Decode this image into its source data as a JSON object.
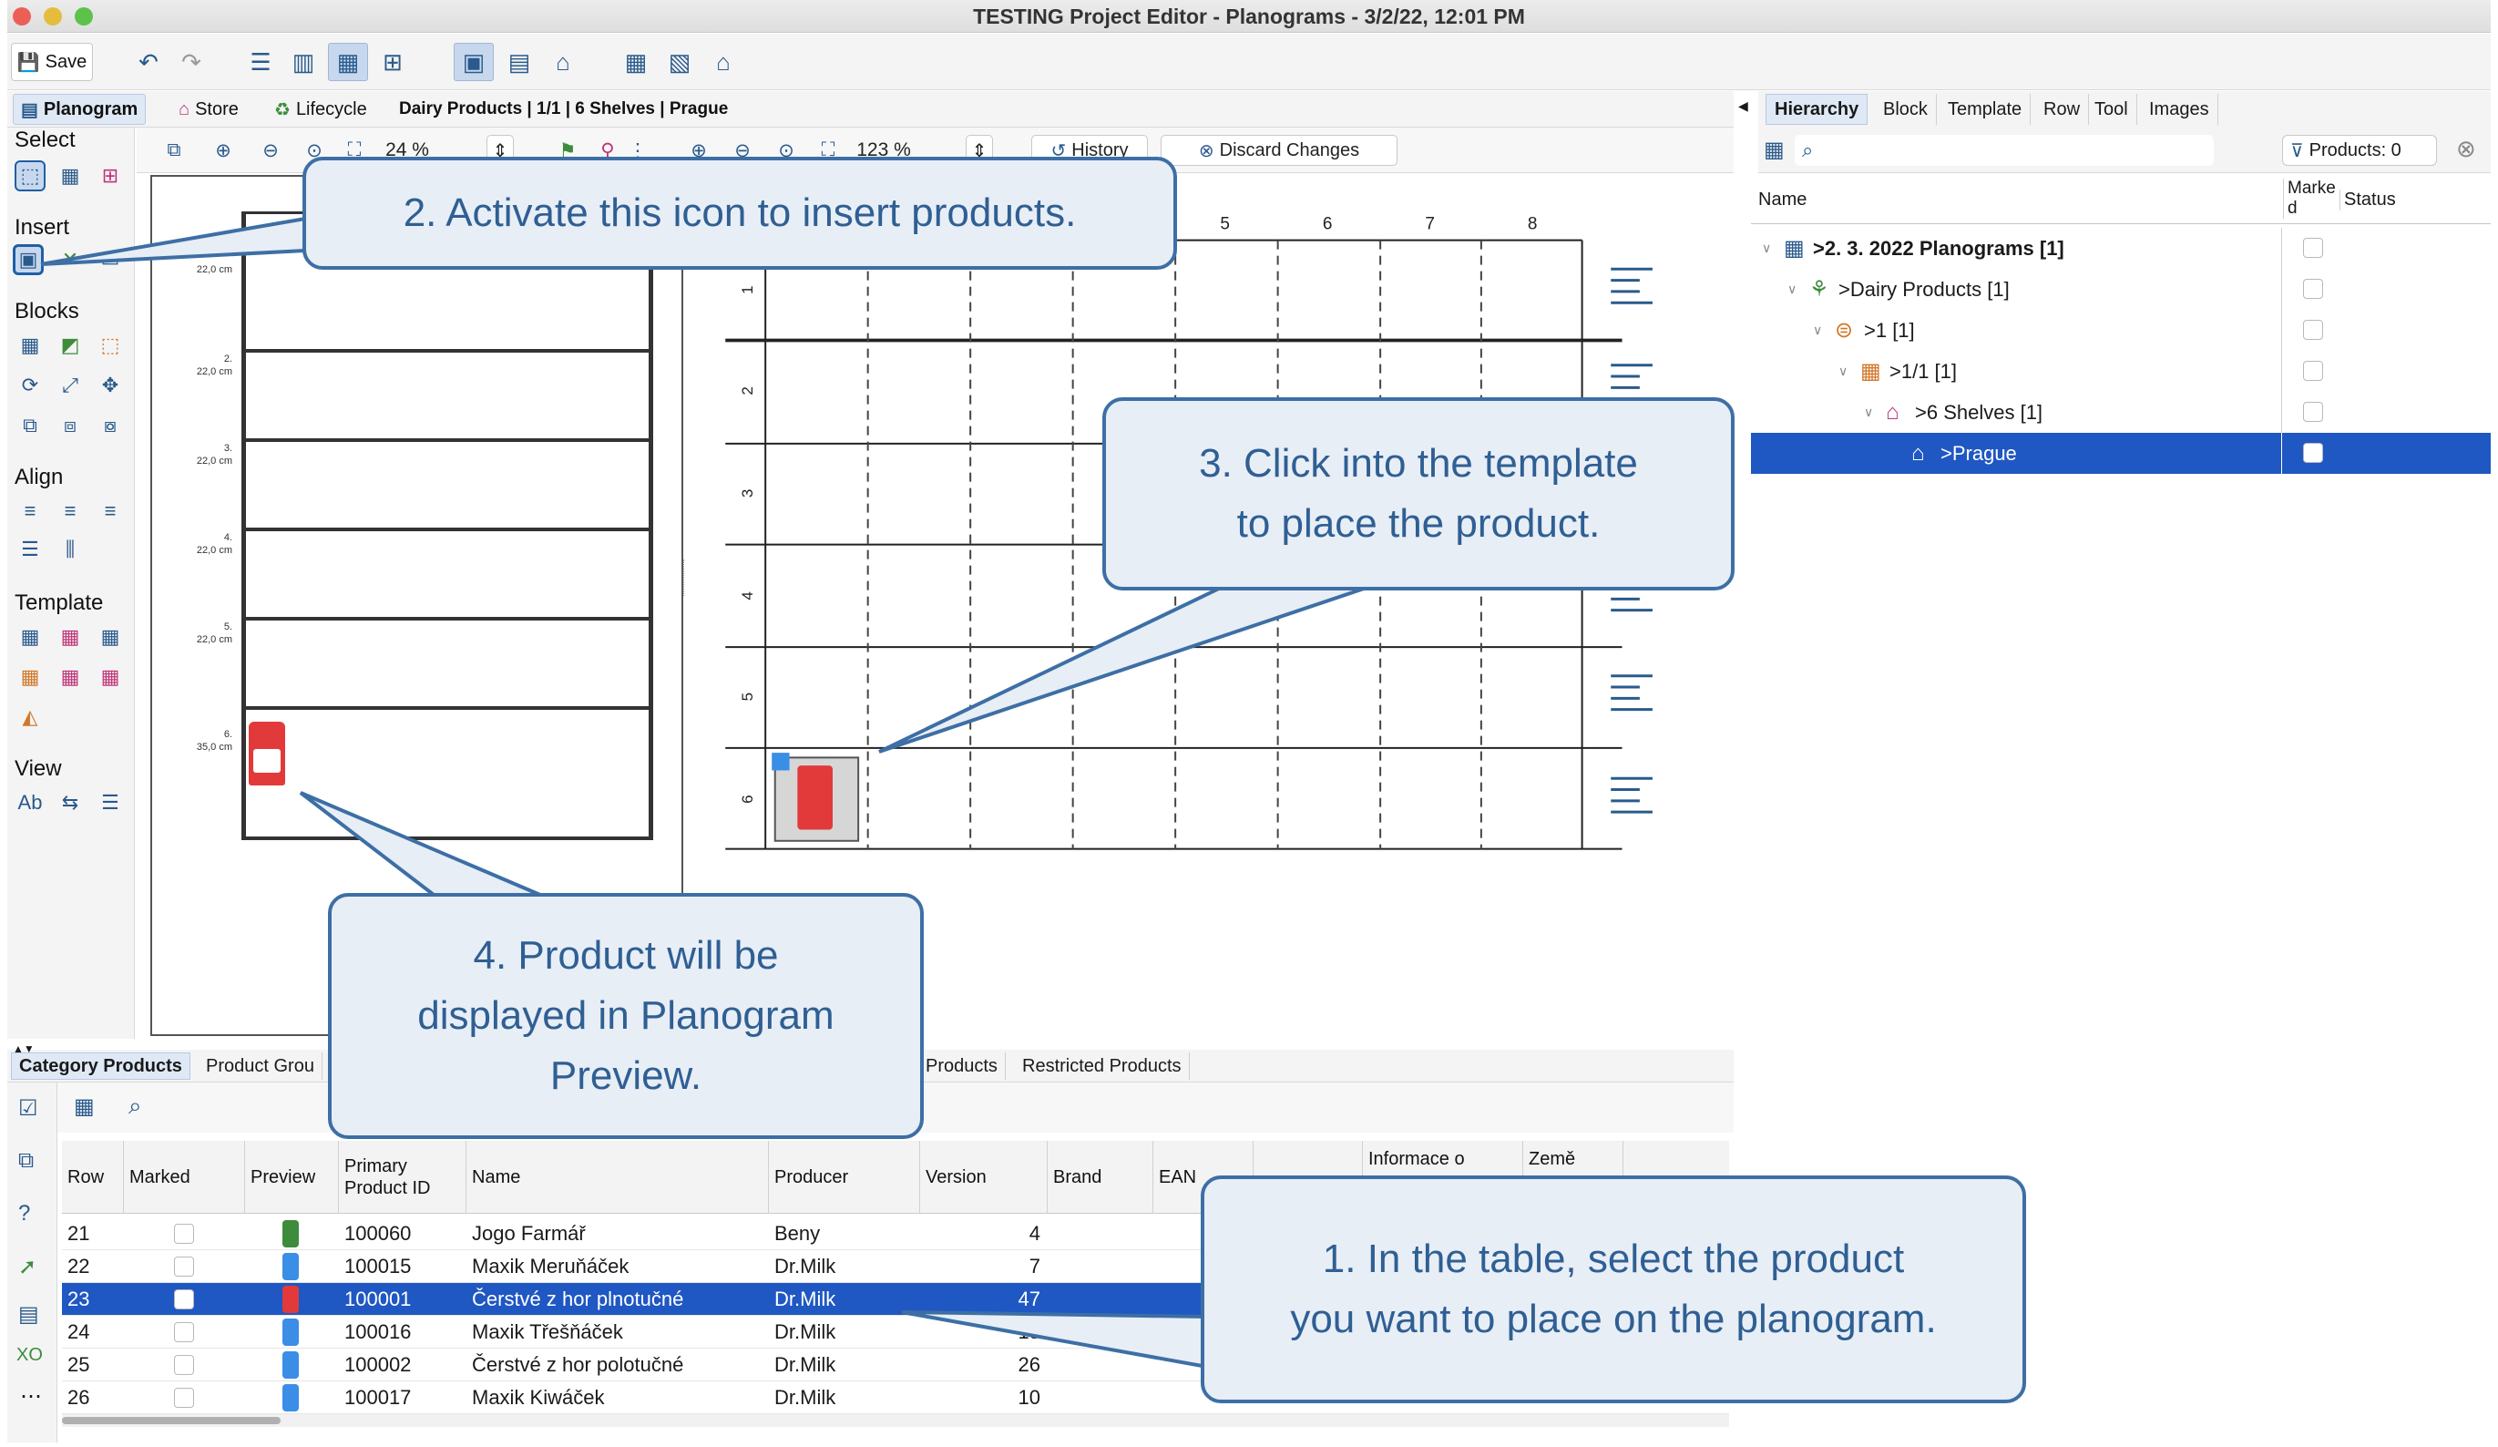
{
  "window": {
    "title": "TESTING Project Editor - Planograms - 3/2/22, 12:01 PM"
  },
  "toolbar": {
    "save_label": "Save"
  },
  "tabs": {
    "planogram": "Planogram",
    "store": "Store",
    "lifecycle": "Lifecycle",
    "info": "Dairy Products | 1/1 | 6 Shelves | Prague"
  },
  "right_tabs": [
    "Hierarchy",
    "Block",
    "Template",
    "Row",
    "Tool",
    "Images"
  ],
  "palette": {
    "select": "Select",
    "insert": "Insert",
    "blocks": "Blocks",
    "align": "Align",
    "template": "Template",
    "view": "View"
  },
  "zoombar": {
    "zoom_left": "24 %",
    "zoom_right": "123 %",
    "history": "History",
    "discard": "Discard Changes"
  },
  "preview": {
    "shelves": [
      {
        "num": "",
        "height": "22,0 cm"
      },
      {
        "num": "2.",
        "height": "22,0 cm"
      },
      {
        "num": "3.",
        "height": "22,0 cm"
      },
      {
        "num": "4.",
        "height": "22,0 cm"
      },
      {
        "num": "5.",
        "height": "22,0 cm"
      },
      {
        "num": "6.",
        "height": "35,0 cm"
      }
    ]
  },
  "template": {
    "columns": [
      "5",
      "6",
      "7",
      "8"
    ],
    "rows": [
      "1",
      "2",
      "3",
      "4",
      "5",
      "6"
    ]
  },
  "hierarchy": {
    "search_placeholder": "",
    "products_count": "Products: 0",
    "col_name": "Name",
    "col_marked": "Marke d",
    "col_status": "Status",
    "rows": [
      {
        "label": ">2. 3. 2022 Planograms [1]"
      },
      {
        "label": ">Dairy Products [1]"
      },
      {
        "label": ">1 [1]"
      },
      {
        "label": ">1/1 [1]"
      },
      {
        "label": ">6 Shelves [1]"
      },
      {
        "label": ">Prague"
      }
    ]
  },
  "bottom_tabs": {
    "category_products": "Category Products",
    "product_groups": "Product Grou",
    "products": "Products",
    "restricted_products": "Restricted Products"
  },
  "table": {
    "headers": {
      "row": "Row",
      "marked": "Marked",
      "preview": "Preview",
      "primary_id": "Primary Product ID",
      "name": "Name",
      "producer": "Producer",
      "version": "Version",
      "brand": "Brand",
      "ean": "EAN",
      "info": "Informace o",
      "country": "Země"
    },
    "rows": [
      {
        "row": "21",
        "id": "100060",
        "name": "Jogo Farmář",
        "producer": "Beny",
        "version": "4"
      },
      {
        "row": "22",
        "id": "100015",
        "name": "Maxik Meruňáček",
        "producer": "Dr.Milk",
        "version": "7"
      },
      {
        "row": "23",
        "id": "100001",
        "name": "Čerstvé z hor plnotučné",
        "producer": "Dr.Milk",
        "version": "47"
      },
      {
        "row": "24",
        "id": "100016",
        "name": "Maxik Třešňáček",
        "producer": "Dr.Milk",
        "version": "15"
      },
      {
        "row": "25",
        "id": "100002",
        "name": "Čerstvé z hor polotučné",
        "producer": "Dr.Milk",
        "version": "26"
      },
      {
        "row": "26",
        "id": "100017",
        "name": "Maxik Kiwáček",
        "producer": "Dr.Milk",
        "version": "10"
      }
    ]
  },
  "callouts": {
    "c1_line1": "1. In the table, select the product",
    "c1_line2": "you want to place on the planogram.",
    "c2": "2. Activate this icon to insert products.",
    "c3_line1": "3. Click into the template",
    "c3_line2": "to place the product.",
    "c4_line1": "4. Product will be",
    "c4_line2": "displayed in Planogram",
    "c4_line3": "Preview."
  },
  "colors": {
    "selection": "#1f57c3",
    "callout_border": "#3d6fa5",
    "callout_fill": "#e8eef6",
    "callout_text": "#2f5f93"
  }
}
